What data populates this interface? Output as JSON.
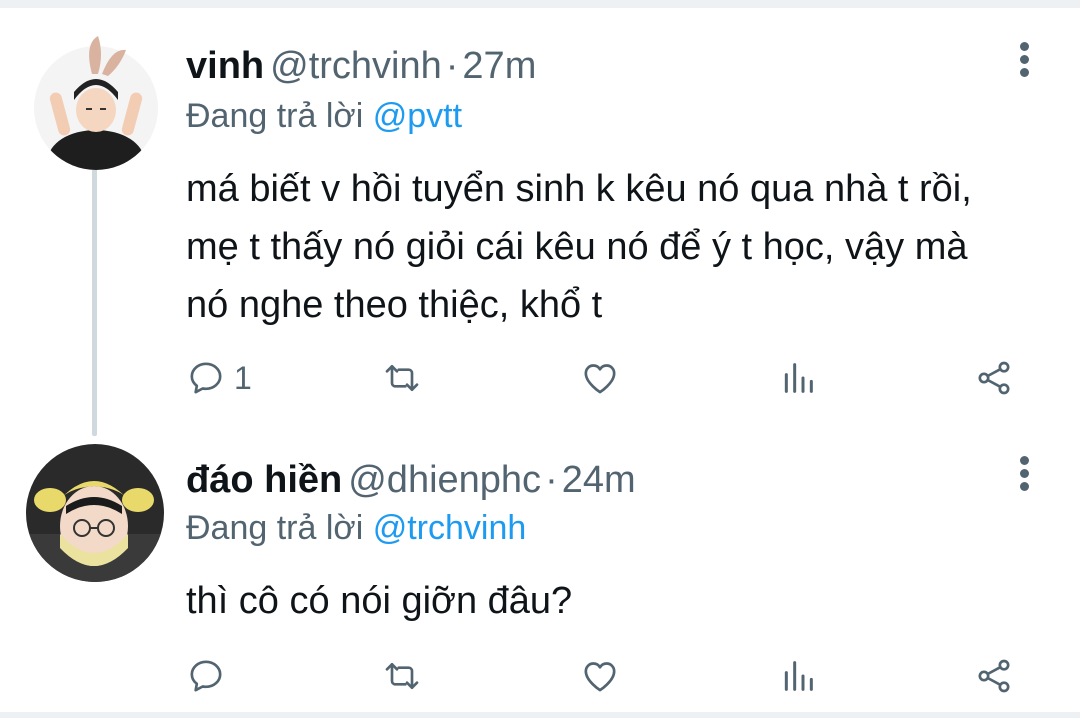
{
  "tweets": [
    {
      "name": "vinh",
      "handle": "@trchvinh",
      "separator": "·",
      "time": "27m",
      "reply_prefix": "Đang trả lời",
      "reply_to": "@pvtt",
      "text_lines": [
        "má biết v hồi tuyển sinh k kêu nó qua nhà t rồi,",
        "mẹ t thấy nó giỏi cái kêu nó để ý t học, vậy mà",
        "nó nghe theo thiệc, khổ t"
      ],
      "reply_count": "1"
    },
    {
      "name": "đáo hiền",
      "handle": "@dhienphc",
      "separator": "·",
      "time": "24m",
      "reply_prefix": "Đang trả lời",
      "reply_to": "@trchvinh",
      "text_lines": [
        "thì cô có nói giỡn đâu?"
      ],
      "reply_count": ""
    }
  ],
  "icons": {
    "reply": "reply-icon",
    "retweet": "retweet-icon",
    "like": "heart-icon",
    "stats": "stats-icon",
    "share": "share-icon",
    "more": "more-icon"
  },
  "colors": {
    "text": "#0f1419",
    "secondary": "#536471",
    "accent": "#1d9bf0",
    "thread_line": "#cfd9de"
  }
}
